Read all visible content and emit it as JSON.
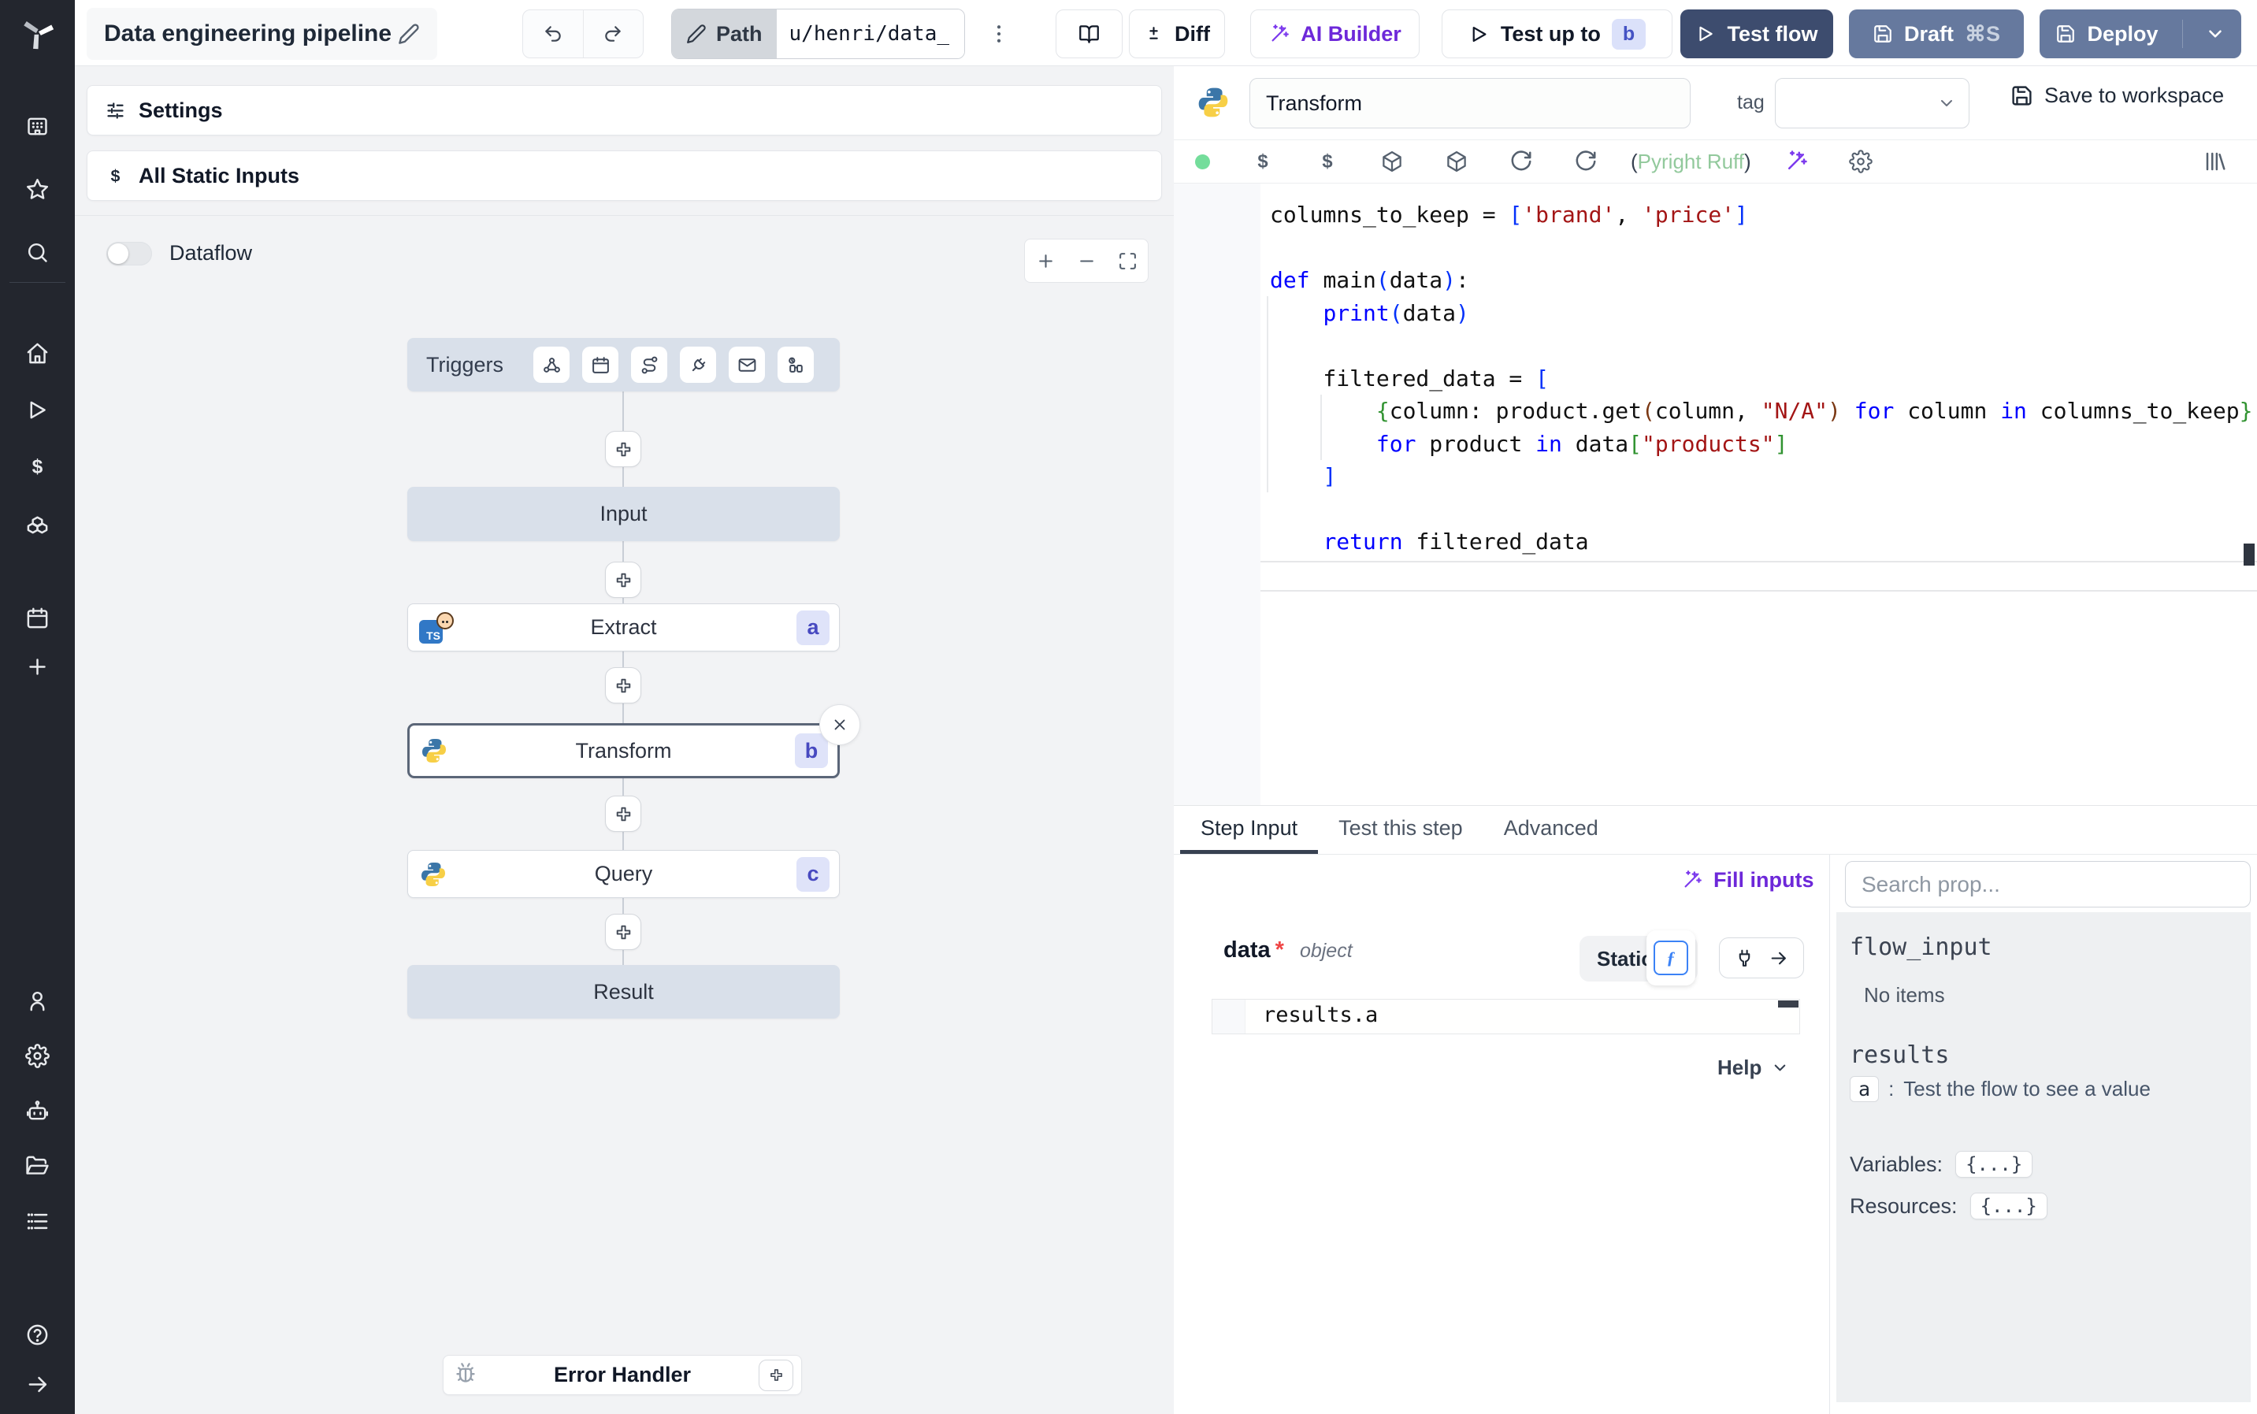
{
  "topbar": {
    "title": "Data engineering pipeline",
    "path_label": "Path",
    "path_value": "u/henri/data_",
    "diff_label": "Diff",
    "ai_builder_label": "AI Builder",
    "test_up_to_label": "Test up to",
    "test_up_to_badge": "b",
    "test_flow_label": "Test flow",
    "draft_label": "Draft",
    "draft_shortcut": "⌘S",
    "deploy_label": "Deploy"
  },
  "sidebar": {
    "top_icons": [
      "store-icon",
      "star-icon",
      "search-icon"
    ],
    "mid_icons": [
      "home-icon",
      "play-icon",
      "dollar-icon",
      "boxes-icon"
    ],
    "util_icons": [
      "calendar-icon",
      "plus-icon"
    ],
    "bottom_icons": [
      "user-icon",
      "gear-icon",
      "bot-icon",
      "folder-icon",
      "list-icon"
    ],
    "footer_icons": [
      "help-icon",
      "arrow-right-icon"
    ]
  },
  "flow_panel": {
    "settings_label": "Settings",
    "static_inputs_label": "All Static Inputs",
    "dataflow_label": "Dataflow",
    "triggers_label": "Triggers",
    "trigger_icons": [
      "webhook-icon",
      "calendar-icon",
      "route-icon",
      "plug-icon",
      "mail-icon",
      "poll-icon"
    ],
    "nodes": [
      {
        "id": "input",
        "label": "Input"
      },
      {
        "id": "a",
        "label": "Extract",
        "lang": "bun",
        "badge": "a"
      },
      {
        "id": "b",
        "label": "Transform",
        "lang": "python",
        "badge": "b",
        "selected": true
      },
      {
        "id": "c",
        "label": "Query",
        "lang": "python",
        "badge": "c"
      },
      {
        "id": "result",
        "label": "Result"
      }
    ],
    "error_handler_label": "Error Handler"
  },
  "editor": {
    "step_name": "Transform",
    "tag_label": "tag",
    "save_label": "Save to workspace",
    "lint_open": "(",
    "lint_label": "Pyright Ruff",
    "lint_close": ")",
    "code_lines": [
      [
        [
          "p",
          "columns_to_keep = "
        ],
        [
          "b1",
          "["
        ],
        [
          "s",
          "'brand'"
        ],
        [
          "p",
          ", "
        ],
        [
          "s",
          "'price'"
        ],
        [
          "b1",
          "]"
        ]
      ],
      [],
      [
        [
          "k",
          "def "
        ],
        [
          "p",
          "main"
        ],
        [
          "b1",
          "("
        ],
        [
          "p",
          "data"
        ],
        [
          "b1",
          ")"
        ],
        [
          "p",
          ":"
        ]
      ],
      [
        [
          "p",
          "    "
        ],
        [
          "k",
          "print"
        ],
        [
          "b1",
          "("
        ],
        [
          "p",
          "data"
        ],
        [
          "b1",
          ")"
        ]
      ],
      [],
      [
        [
          "p",
          "    filtered_data = "
        ],
        [
          "b1",
          "["
        ]
      ],
      [
        [
          "p",
          "        "
        ],
        [
          "b2",
          "{"
        ],
        [
          "p",
          "column: product.get"
        ],
        [
          "b3",
          "("
        ],
        [
          "p",
          "column, "
        ],
        [
          "s",
          "\"N/A\""
        ],
        [
          "b3",
          ")"
        ],
        [
          "k",
          " for "
        ],
        [
          "p",
          "column"
        ],
        [
          "k",
          " in "
        ],
        [
          "p",
          "columns_to_keep"
        ],
        [
          "b2",
          "}"
        ]
      ],
      [
        [
          "p",
          "        "
        ],
        [
          "k",
          "for "
        ],
        [
          "p",
          "product "
        ],
        [
          "k",
          "in "
        ],
        [
          "p",
          "data"
        ],
        [
          "b2",
          "["
        ],
        [
          "s",
          "\"products\""
        ],
        [
          "b2",
          "]"
        ]
      ],
      [
        [
          "p",
          "    "
        ],
        [
          "b1",
          "]"
        ]
      ],
      [],
      [
        [
          "p",
          "    "
        ],
        [
          "k",
          "return "
        ],
        [
          "p",
          "filtered_data"
        ]
      ]
    ]
  },
  "step_panel": {
    "tabs": [
      "Step Input",
      "Test this step",
      "Advanced"
    ],
    "active_tab": "Step Input",
    "fill_inputs_label": "Fill inputs",
    "arg_name": "data",
    "arg_required": "*",
    "arg_type": "object",
    "static_label": "Static",
    "expr_value": "results.a",
    "help_label": "Help"
  },
  "props_panel": {
    "search_placeholder": "Search prop...",
    "flow_input_label": "flow_input",
    "flow_input_empty": "No items",
    "results_label": "results",
    "result_key": "a",
    "result_sep": ":",
    "result_hint": "Test the flow to see a value",
    "variables_label": "Variables:",
    "variables_value": "{...}",
    "resources_label": "Resources:",
    "resources_value": "{...}"
  },
  "colors": {
    "accent_purple": "#6d28d9",
    "navy_button": "#3d4c6e",
    "slate_button": "#66799e",
    "badge_bg": "#dfe3f9",
    "badge_text": "#4749c0",
    "selected_node_border": "#5b6678",
    "virtual_node_bg": "#d9e0ea",
    "lint_green": "#92c99c",
    "rail_bg": "#23262e"
  }
}
